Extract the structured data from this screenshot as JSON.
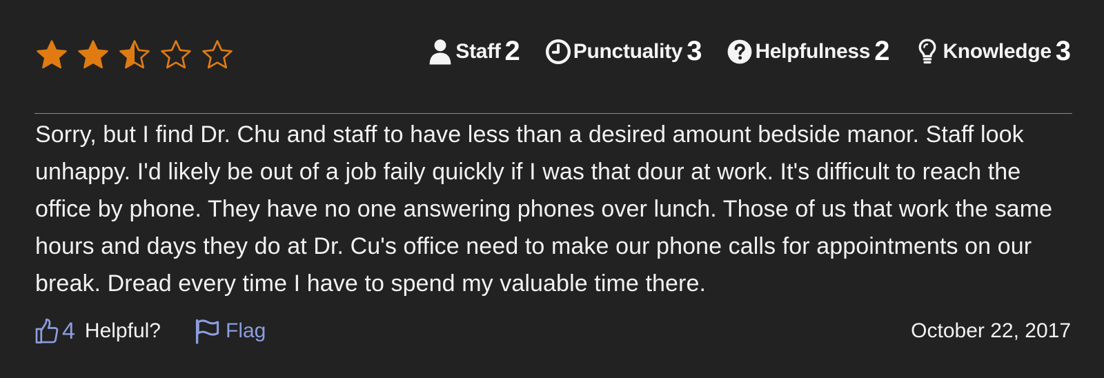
{
  "review": {
    "star_rating": 2.5,
    "star_max": 5,
    "star_color": "#e07b12",
    "ratings": [
      {
        "icon": "user-icon",
        "label": "Staff",
        "score": "2"
      },
      {
        "icon": "clock-icon",
        "label": "Punctuality",
        "score": "3"
      },
      {
        "icon": "question-circle-icon",
        "label": "Helpfulness",
        "score": "2"
      },
      {
        "icon": "lightbulb-icon",
        "label": "Knowledge",
        "score": "3"
      }
    ],
    "text": "Sorry, but I find Dr. Chu and staff to have less than a desired amount bedside manor. Staff look unhappy. I'd likely be out of a job faily quickly if I was that dour at work. It's difficult to reach the office by phone. They have no one answering phones over lunch. Those of us that work the same hours and days they do at Dr. Cu's office need to make our phone calls for appointments on our break. Dread every time I have to spend my valuable time there.",
    "helpful": {
      "icon": "thumbs-up-icon",
      "count": "4",
      "label": "Helpful?",
      "color": "#8c9ee0"
    },
    "flag": {
      "icon": "flag-icon",
      "label": "Flag"
    },
    "date": "October 22, 2017"
  }
}
